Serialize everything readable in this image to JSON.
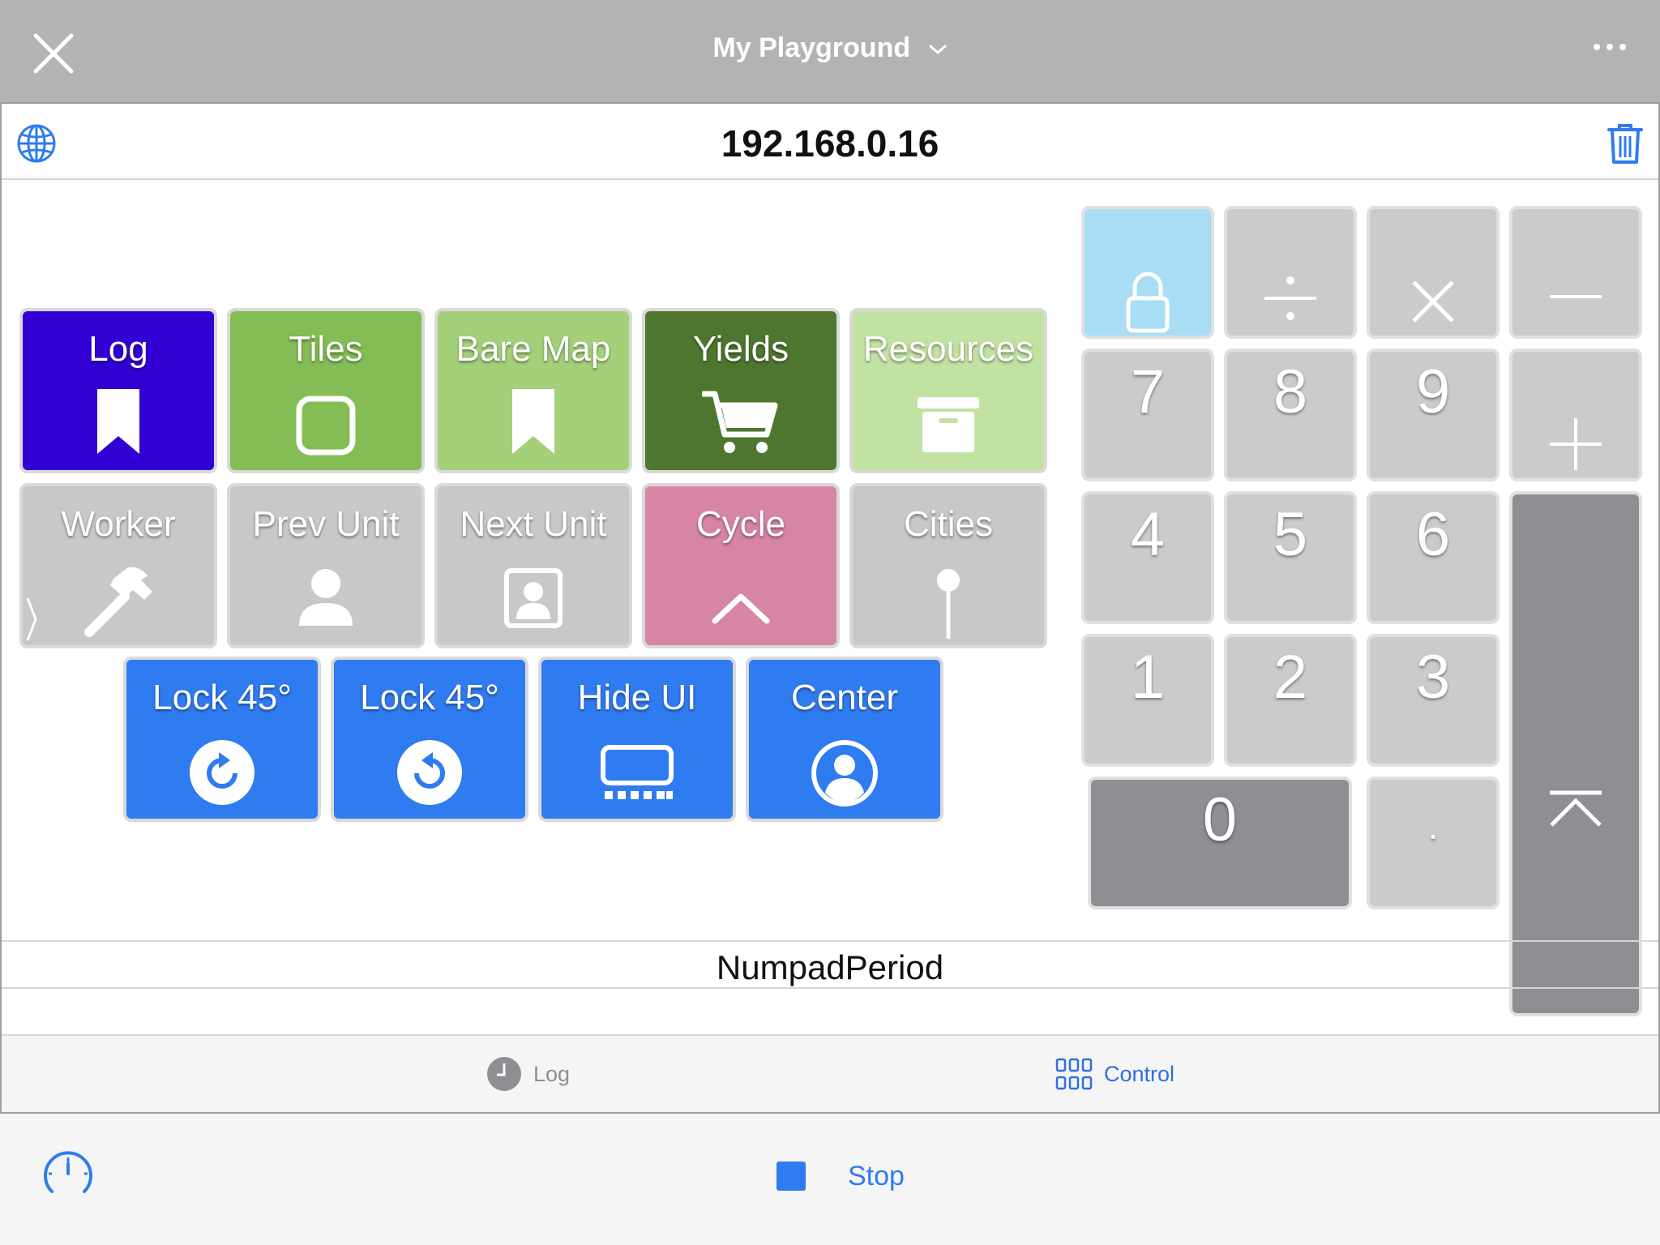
{
  "nav": {
    "title": "My Playground"
  },
  "address": {
    "ip": "192.168.0.16"
  },
  "tiles_row1": [
    {
      "label": "Log",
      "color": "#3200d4",
      "icon": "bookmark-icon"
    },
    {
      "label": "Tiles",
      "color": "#84bd55",
      "icon": "square-icon"
    },
    {
      "label": "Bare Map",
      "color": "#a4d07a",
      "icon": "bookmark-icon"
    },
    {
      "label": "Yields",
      "color": "#4f762f",
      "icon": "cart-icon"
    },
    {
      "label": "Resources",
      "color": "#c2e2a2",
      "icon": "archive-box-icon"
    }
  ],
  "tiles_row2": [
    {
      "label": "Worker",
      "color": "#c8c8c8",
      "icon": "hammer-icon"
    },
    {
      "label": "Prev Unit",
      "color": "#c8c8c8",
      "icon": "person-icon"
    },
    {
      "label": "Next Unit",
      "color": "#c8c8c8",
      "icon": "person-square-icon"
    },
    {
      "label": "Cycle",
      "color": "#d685a4",
      "icon": "chevron-up-icon"
    },
    {
      "label": "Cities",
      "color": "#c8c8c8",
      "icon": "pin-icon"
    }
  ],
  "tiles_row3": [
    {
      "label": "Lock 45°",
      "color": "#2f7bf0",
      "icon": "rotate-cw-icon"
    },
    {
      "label": "Lock 45°",
      "color": "#2f7bf0",
      "icon": "rotate-ccw-icon"
    },
    {
      "label": "Hide UI",
      "color": "#2f7bf0",
      "icon": "keyboard-icon"
    },
    {
      "label": "Center",
      "color": "#2f7bf0",
      "icon": "person-circle-icon"
    }
  ],
  "numpad": {
    "keys": [
      "7",
      "8",
      "9",
      "4",
      "5",
      "6",
      "1",
      "2",
      "3",
      "0",
      "."
    ],
    "lock_color": "#a9dcf5",
    "dark_key_color": "#8e8e93"
  },
  "status": {
    "text": "NumpadPeriod"
  },
  "tabs": {
    "log": "Log",
    "control": "Control"
  },
  "toolbar": {
    "stop_label": "Stop"
  }
}
